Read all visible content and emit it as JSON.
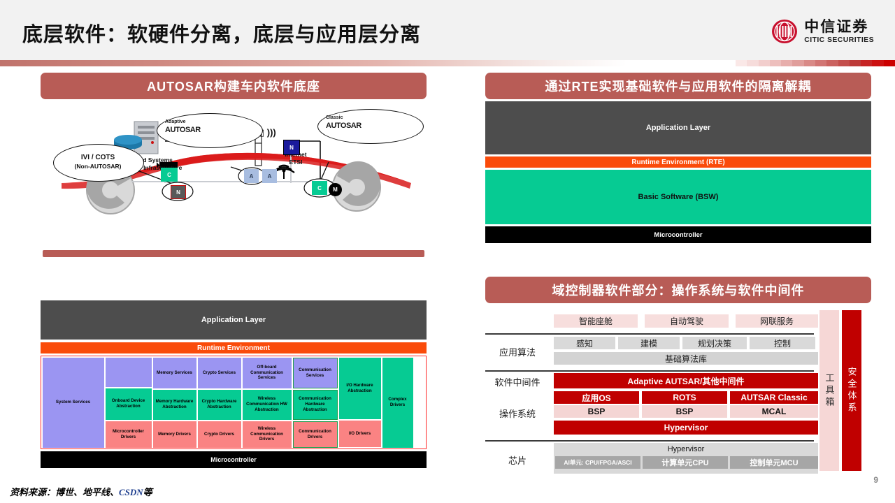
{
  "header": {
    "title": "底层软件：软硬件分离，底层与应用层分离",
    "logo_cn": "中信证券",
    "logo_en": "CITIC SECURITIES",
    "stripe_colors": [
      "#fae8e7",
      "#f6dcdb",
      "#f2cecd",
      "#edbfbd",
      "#e7aeac",
      "#e09e9b",
      "#d98a87",
      "#d27674",
      "#cb6360",
      "#c44f4c",
      "#bd3b38",
      "#c62424",
      "#cc1111",
      "#cc0000"
    ]
  },
  "colors": {
    "panel_title_bg": "#b85c56",
    "rte_orange": "#fa4b0a",
    "bsw_green": "#06cb93",
    "app_gray": "#4d4d4d",
    "brand_red": "#c00000"
  },
  "panels": {
    "top_left": {
      "title": "AUTOSAR构建车内软件底座",
      "illustration": {
        "backend_label": "Backend Systems\nRoad-Side Infrastructure",
        "internet_label": "Internet\nETSI",
        "antenna_symbol": "((( ▯▯ )))",
        "bubbles": [
          {
            "name": "ivi-cots",
            "line1": "IVI / COTS",
            "line2": "(Non-AUTOSAR)"
          },
          {
            "name": "adaptive-autosar",
            "line1": "Adaptive",
            "line2": "AUTOSAR"
          },
          {
            "name": "classic-autosar",
            "line1": "Classic",
            "line2": "AUTOSAR"
          }
        ],
        "nodes": [
          {
            "name": "node-c-left",
            "label": "C"
          },
          {
            "name": "node-n-bottom",
            "label": "N"
          },
          {
            "name": "node-a1",
            "label": "A"
          },
          {
            "name": "node-a2",
            "label": "A"
          },
          {
            "name": "node-n-top",
            "label": "N"
          },
          {
            "name": "node-c-right",
            "label": "C"
          },
          {
            "name": "node-m-right",
            "label": "M"
          }
        ]
      }
    },
    "bottom_left": {
      "application_layer": "Application Layer",
      "runtime_environment": "Runtime Environment",
      "microcontroller": "Microcontroller",
      "columns": [
        {
          "top": "System Services",
          "mid": "",
          "bot": "",
          "span": "full"
        },
        {
          "top": "",
          "mid": "Onboard\nDevice\nAbstraction",
          "bot": "Microcontroller\nDrivers"
        },
        {
          "top": "Memory\nServices",
          "mid": "Memory\nHardware\nAbstraction",
          "bot": "Memory\nDrivers"
        },
        {
          "top": "Crypto\nServices",
          "mid": "Crypto\nHardware\nAbstraction",
          "bot": "Crypto Drivers"
        },
        {
          "top": "Off-board\nCommunication\nServices",
          "mid": "Wireless\nCommunication\nHW Abstraction",
          "bot": "Wireless\nCommunication\nDrivers"
        },
        {
          "top": "Communication\nServices",
          "mid": "Communication\nHardware\nAbstraction",
          "bot": "Communication\nDrivers"
        },
        {
          "top": "I/O Hardware\nAbstraction",
          "mid": "",
          "bot": "I/O Drivers"
        },
        {
          "top": "Complex\nDrivers",
          "mid": "",
          "bot": ""
        }
      ]
    },
    "top_right": {
      "title": "通过RTE实现基础软件与应用软件的隔离解耦",
      "layers": [
        {
          "name": "application-layer",
          "label": "Application Layer"
        },
        {
          "name": "runtime-environment-layer",
          "label": "Runtime Environment (RTE)"
        },
        {
          "name": "basic-software-layer",
          "label": "Basic Software (BSW)"
        },
        {
          "name": "microcontroller-layer",
          "label": "Microcontroller"
        }
      ]
    },
    "bottom_right": {
      "title": "域控制器软件部分：操作系统与软件中间件",
      "row_labels": [
        "应用算法",
        "软件中间件",
        "操作系统",
        "芯片"
      ],
      "domains": [
        "智能座舱",
        "自动驾驶",
        "网联服务"
      ],
      "algorithms": [
        "感知",
        "建模",
        "规划决策",
        "控制"
      ],
      "algorithm_library": "基础算法库",
      "middleware": "Adaptive AUTSAR/其他中间件",
      "os_top": [
        "应用OS",
        "ROTS",
        "AUTSAR Classic"
      ],
      "os_bottom": [
        "BSP",
        "BSP",
        "MCAL"
      ],
      "hypervisor_os": "Hypervisor",
      "hypervisor_chip": "Hypervisor",
      "chips": [
        "AI单元: CPU/FPGA/ASCI",
        "计算单元CPU",
        "控制单元MCU"
      ],
      "side_columns": [
        "工具箱",
        "安全体系"
      ]
    }
  },
  "footer": {
    "source_prefix": "资料来源：博世、地平线、",
    "source_highlight": "CSDN",
    "source_suffix": "等",
    "page_number": "9"
  }
}
